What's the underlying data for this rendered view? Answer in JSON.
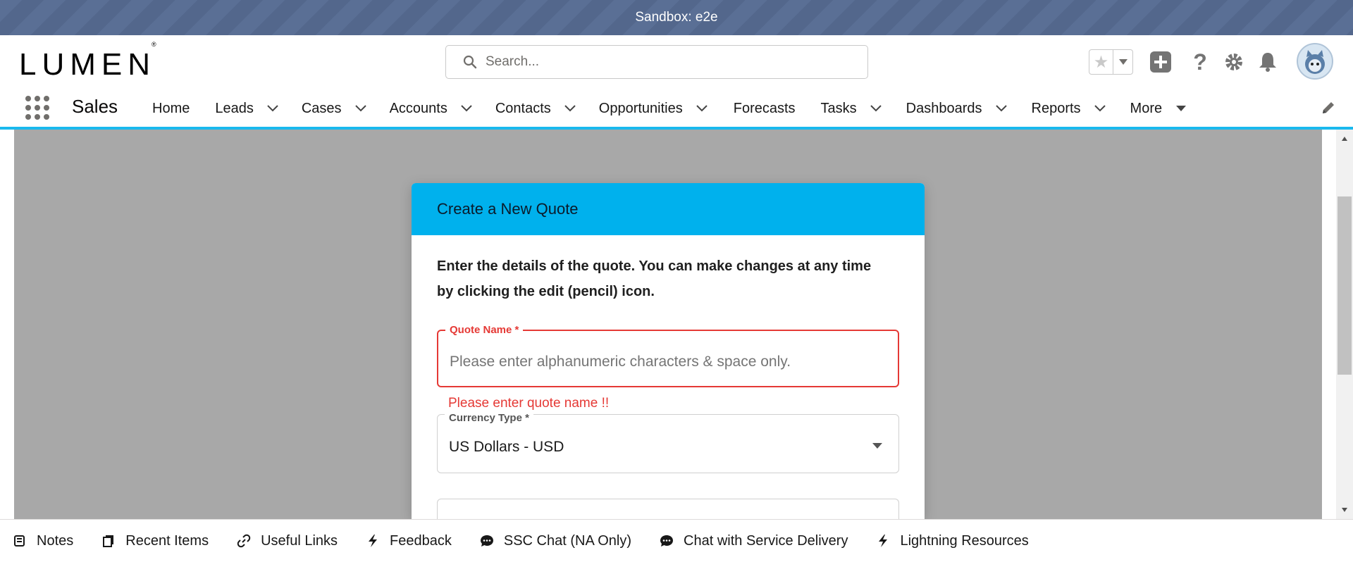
{
  "sandbox": {
    "label": "Sandbox: e2e"
  },
  "header": {
    "logo_text": "LUMEN",
    "logo_mark": "®",
    "search_placeholder": "Search...",
    "icons": [
      "star-icon",
      "chevron-down-icon",
      "add-icon",
      "help-icon",
      "setup-gear-icon",
      "notification-bell-icon",
      "avatar"
    ]
  },
  "app_nav": {
    "app_name": "Sales",
    "items": [
      {
        "label": "Home",
        "has_menu": false
      },
      {
        "label": "Leads",
        "has_menu": true
      },
      {
        "label": "Cases",
        "has_menu": true
      },
      {
        "label": "Accounts",
        "has_menu": true
      },
      {
        "label": "Contacts",
        "has_menu": true
      },
      {
        "label": "Opportunities",
        "has_menu": true
      },
      {
        "label": "Forecasts",
        "has_menu": false
      },
      {
        "label": "Tasks",
        "has_menu": true
      },
      {
        "label": "Dashboards",
        "has_menu": true
      },
      {
        "label": "Reports",
        "has_menu": true
      },
      {
        "label": "More",
        "has_menu": true
      }
    ]
  },
  "modal": {
    "title": "Create a New Quote",
    "intro_line1": "Enter the details of the quote. You can make changes at any time",
    "intro_line2": "by clicking the edit (pencil) icon.",
    "quote_name_label": "Quote Name *",
    "quote_name_placeholder": "Please enter alphanumeric characters & space only.",
    "quote_name_value": "",
    "quote_name_error": "Please enter quote name !!",
    "currency_label": "Currency Type *",
    "currency_value": "US Dollars - USD"
  },
  "utility_bar": {
    "items": [
      {
        "label": "Notes",
        "icon": "notes-icon"
      },
      {
        "label": "Recent Items",
        "icon": "recent-items-icon"
      },
      {
        "label": "Useful Links",
        "icon": "link-icon"
      },
      {
        "label": "Feedback",
        "icon": "lightning-icon"
      },
      {
        "label": "SSC Chat (NA Only)",
        "icon": "chat-icon"
      },
      {
        "label": "Chat with Service Delivery",
        "icon": "chat-icon"
      },
      {
        "label": "Lightning Resources",
        "icon": "lightning-icon"
      }
    ]
  },
  "colors": {
    "accent": "#00b1ed",
    "error": "#e53935",
    "sandbox_bar": "#5a6f95",
    "overlay": "#a8a8a8"
  }
}
